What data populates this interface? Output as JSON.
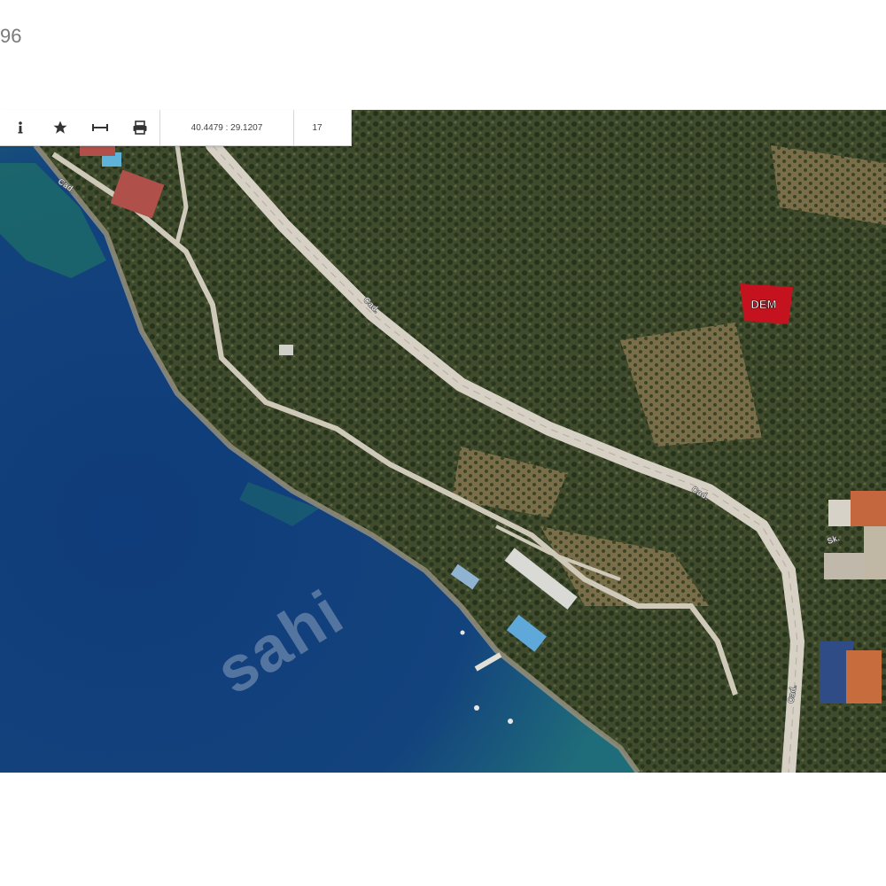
{
  "header": {
    "label": "96"
  },
  "toolbar": {
    "coordinates": "40.4479 : 29.1207",
    "zoom_level": "17"
  },
  "map": {
    "parcel_label": "DEM",
    "watermark": "sahi",
    "road_labels": [
      "Cad.",
      "Cad.",
      "Cad.",
      "Sk.",
      "Cad."
    ]
  },
  "colors": {
    "sea_deep": "#123f78",
    "sea_shallow": "#1d7a72",
    "land_dark": "#2c3a22",
    "land_mid": "#4e5a35",
    "field": "#8a7a52",
    "road": "#d9d4c8",
    "parcel_marker": "#c4121e"
  }
}
